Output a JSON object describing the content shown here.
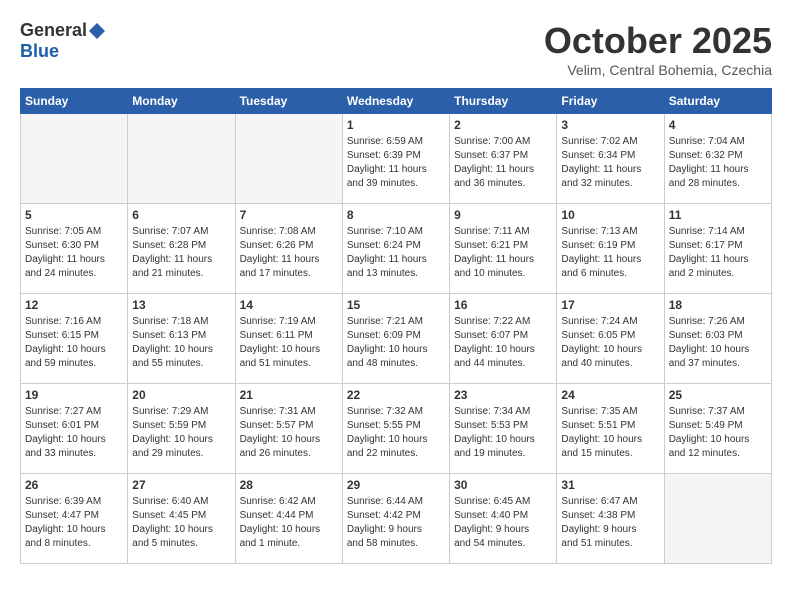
{
  "header": {
    "logo_general": "General",
    "logo_blue": "Blue",
    "month_title": "October 2025",
    "location": "Velim, Central Bohemia, Czechia"
  },
  "weekdays": [
    "Sunday",
    "Monday",
    "Tuesday",
    "Wednesday",
    "Thursday",
    "Friday",
    "Saturday"
  ],
  "weeks": [
    [
      {
        "day": "",
        "info": ""
      },
      {
        "day": "",
        "info": ""
      },
      {
        "day": "",
        "info": ""
      },
      {
        "day": "1",
        "info": "Sunrise: 6:59 AM\nSunset: 6:39 PM\nDaylight: 11 hours\nand 39 minutes."
      },
      {
        "day": "2",
        "info": "Sunrise: 7:00 AM\nSunset: 6:37 PM\nDaylight: 11 hours\nand 36 minutes."
      },
      {
        "day": "3",
        "info": "Sunrise: 7:02 AM\nSunset: 6:34 PM\nDaylight: 11 hours\nand 32 minutes."
      },
      {
        "day": "4",
        "info": "Sunrise: 7:04 AM\nSunset: 6:32 PM\nDaylight: 11 hours\nand 28 minutes."
      }
    ],
    [
      {
        "day": "5",
        "info": "Sunrise: 7:05 AM\nSunset: 6:30 PM\nDaylight: 11 hours\nand 24 minutes."
      },
      {
        "day": "6",
        "info": "Sunrise: 7:07 AM\nSunset: 6:28 PM\nDaylight: 11 hours\nand 21 minutes."
      },
      {
        "day": "7",
        "info": "Sunrise: 7:08 AM\nSunset: 6:26 PM\nDaylight: 11 hours\nand 17 minutes."
      },
      {
        "day": "8",
        "info": "Sunrise: 7:10 AM\nSunset: 6:24 PM\nDaylight: 11 hours\nand 13 minutes."
      },
      {
        "day": "9",
        "info": "Sunrise: 7:11 AM\nSunset: 6:21 PM\nDaylight: 11 hours\nand 10 minutes."
      },
      {
        "day": "10",
        "info": "Sunrise: 7:13 AM\nSunset: 6:19 PM\nDaylight: 11 hours\nand 6 minutes."
      },
      {
        "day": "11",
        "info": "Sunrise: 7:14 AM\nSunset: 6:17 PM\nDaylight: 11 hours\nand 2 minutes."
      }
    ],
    [
      {
        "day": "12",
        "info": "Sunrise: 7:16 AM\nSunset: 6:15 PM\nDaylight: 10 hours\nand 59 minutes."
      },
      {
        "day": "13",
        "info": "Sunrise: 7:18 AM\nSunset: 6:13 PM\nDaylight: 10 hours\nand 55 minutes."
      },
      {
        "day": "14",
        "info": "Sunrise: 7:19 AM\nSunset: 6:11 PM\nDaylight: 10 hours\nand 51 minutes."
      },
      {
        "day": "15",
        "info": "Sunrise: 7:21 AM\nSunset: 6:09 PM\nDaylight: 10 hours\nand 48 minutes."
      },
      {
        "day": "16",
        "info": "Sunrise: 7:22 AM\nSunset: 6:07 PM\nDaylight: 10 hours\nand 44 minutes."
      },
      {
        "day": "17",
        "info": "Sunrise: 7:24 AM\nSunset: 6:05 PM\nDaylight: 10 hours\nand 40 minutes."
      },
      {
        "day": "18",
        "info": "Sunrise: 7:26 AM\nSunset: 6:03 PM\nDaylight: 10 hours\nand 37 minutes."
      }
    ],
    [
      {
        "day": "19",
        "info": "Sunrise: 7:27 AM\nSunset: 6:01 PM\nDaylight: 10 hours\nand 33 minutes."
      },
      {
        "day": "20",
        "info": "Sunrise: 7:29 AM\nSunset: 5:59 PM\nDaylight: 10 hours\nand 29 minutes."
      },
      {
        "day": "21",
        "info": "Sunrise: 7:31 AM\nSunset: 5:57 PM\nDaylight: 10 hours\nand 26 minutes."
      },
      {
        "day": "22",
        "info": "Sunrise: 7:32 AM\nSunset: 5:55 PM\nDaylight: 10 hours\nand 22 minutes."
      },
      {
        "day": "23",
        "info": "Sunrise: 7:34 AM\nSunset: 5:53 PM\nDaylight: 10 hours\nand 19 minutes."
      },
      {
        "day": "24",
        "info": "Sunrise: 7:35 AM\nSunset: 5:51 PM\nDaylight: 10 hours\nand 15 minutes."
      },
      {
        "day": "25",
        "info": "Sunrise: 7:37 AM\nSunset: 5:49 PM\nDaylight: 10 hours\nand 12 minutes."
      }
    ],
    [
      {
        "day": "26",
        "info": "Sunrise: 6:39 AM\nSunset: 4:47 PM\nDaylight: 10 hours\nand 8 minutes."
      },
      {
        "day": "27",
        "info": "Sunrise: 6:40 AM\nSunset: 4:45 PM\nDaylight: 10 hours\nand 5 minutes."
      },
      {
        "day": "28",
        "info": "Sunrise: 6:42 AM\nSunset: 4:44 PM\nDaylight: 10 hours\nand 1 minute."
      },
      {
        "day": "29",
        "info": "Sunrise: 6:44 AM\nSunset: 4:42 PM\nDaylight: 9 hours\nand 58 minutes."
      },
      {
        "day": "30",
        "info": "Sunrise: 6:45 AM\nSunset: 4:40 PM\nDaylight: 9 hours\nand 54 minutes."
      },
      {
        "day": "31",
        "info": "Sunrise: 6:47 AM\nSunset: 4:38 PM\nDaylight: 9 hours\nand 51 minutes."
      },
      {
        "day": "",
        "info": ""
      }
    ]
  ]
}
